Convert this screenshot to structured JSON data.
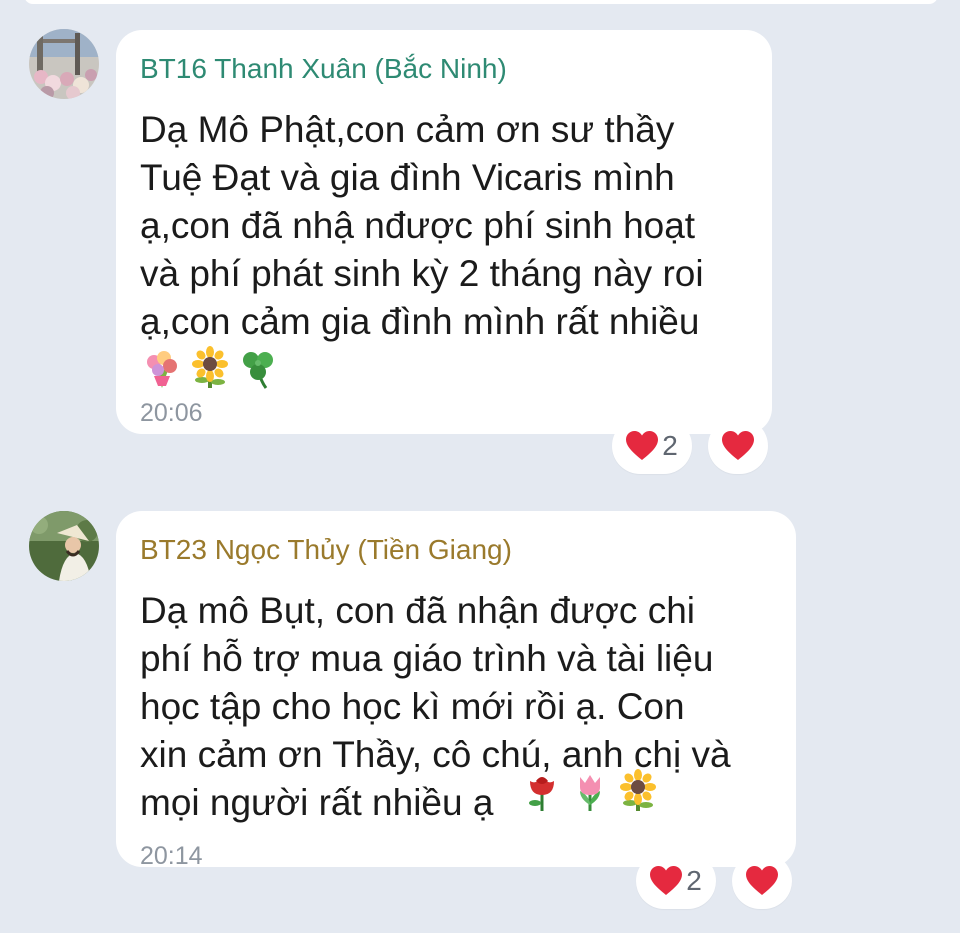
{
  "colors": {
    "background": "#e4e9f1",
    "bubble": "#ffffff",
    "sender1": "#2e8a73",
    "sender2": "#9a7a2c",
    "time": "#8e96a0",
    "heart": "#e5293f"
  },
  "messages": [
    {
      "sender": "BT16 Thanh Xuân (Bắc Ninh)",
      "text": "Dạ Mô Phật,con cảm ơn sư thầy\nTuệ Đạt và gia đình Vicaris mình\nạ,con đã nhậ nđược phí sinh hoạt\nvà phí phát sinh kỳ 2 tháng này roi\nạ,con cảm gia đình mình rất nhiều",
      "emojis": [
        "bouquet-emoji",
        "sunflower-emoji",
        "clover-emoji"
      ],
      "time": "20:06",
      "reaction_count": "2"
    },
    {
      "sender": "BT23 Ngọc Thủy (Tiền Giang)",
      "text": "Dạ mô Bụt, con đã nhận được chi\nphí  hỗ trợ mua giáo trình và tài liệu\nhọc tập cho học kì mới rồi ạ. Con\nxin cảm ơn Thầy, cô chú, anh chị và\nmọi người rất nhiều ạ",
      "emojis": [
        "rose-emoji",
        "tulip-emoji",
        "sunflower-emoji"
      ],
      "time": "20:14",
      "reaction_count": "2"
    }
  ]
}
